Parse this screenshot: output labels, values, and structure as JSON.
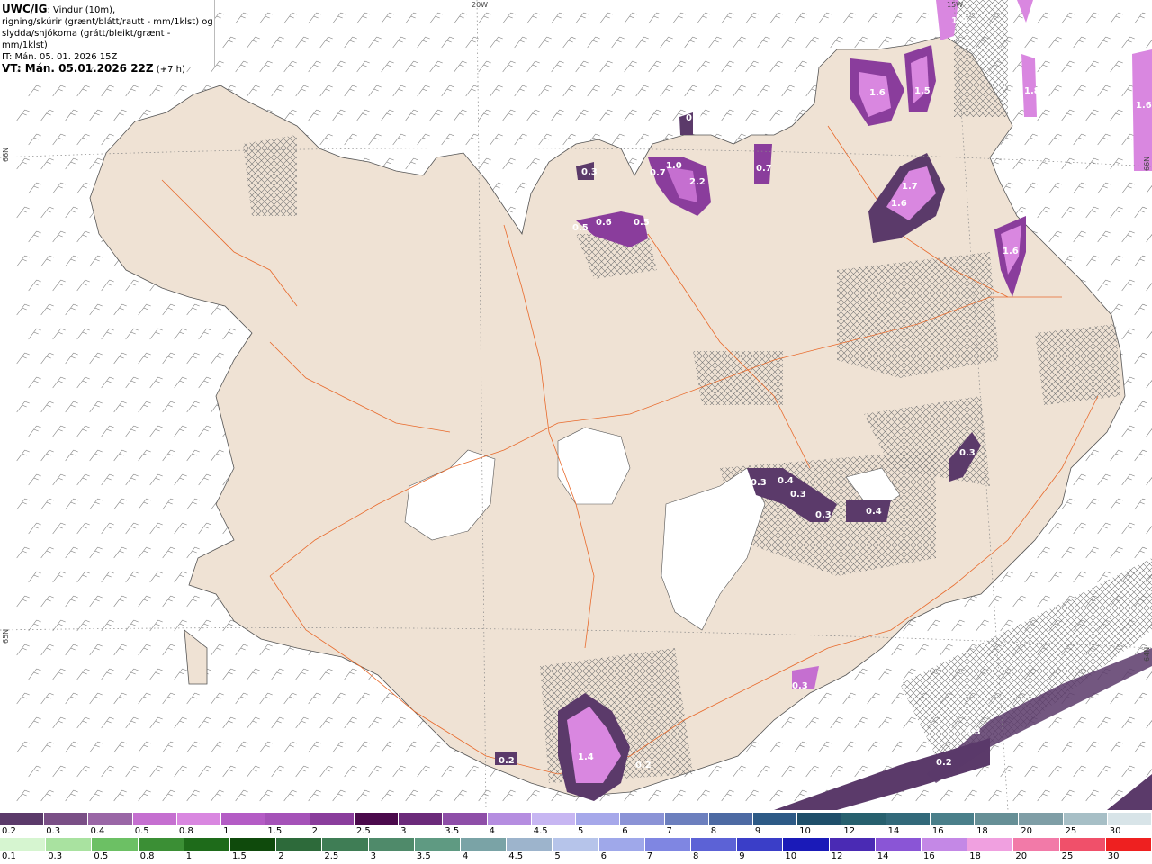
{
  "header": {
    "model": "UWC/IG",
    "line1_rest": ": Vindur (10m),",
    "line2": "rigning/skúrir (grænt/blátt/rautt - mm/1klst) og",
    "line3": "slydda/snjókoma (grátt/bleikt/grænt - mm/1klst)",
    "init_time": "IT: Mán. 05. 01. 2026 15Z",
    "valid_label": "VT: Mán. 05.01.2026 22Z",
    "valid_offset": "(+7 h)"
  },
  "grid_labels": [
    "20W",
    "15W",
    "66N",
    "65N",
    "66N",
    "64N"
  ],
  "precip_values": [
    "1.6",
    "1.5",
    "1.8",
    "1.8",
    "1.6",
    "1.7",
    "1.6",
    "1.6",
    "0.3",
    "0.7",
    "1.0",
    "2.2",
    "0.7",
    "0.5",
    "0.6",
    "0.5",
    "0.7",
    "0.3",
    "0.4",
    "0.3",
    "0.3",
    "0.4",
    "0.3",
    "1.4",
    "0.2",
    "0.3",
    "0.2",
    "0.2",
    "0.3"
  ],
  "legend": {
    "top_labels": [
      "0.2",
      "0.3",
      "0.4",
      "0.5",
      "0.8",
      "1",
      "1.5",
      "2",
      "2.5",
      "3",
      "3.5",
      "4",
      "4.5",
      "5",
      "6",
      "7",
      "8",
      "9",
      "10",
      "12",
      "14",
      "16",
      "18",
      "20",
      "25",
      "30"
    ],
    "top_colors": [
      "#5b3a6a",
      "#7a4f86",
      "#9a66a6",
      "#c56fd0",
      "#d987e0",
      "#b45cc5",
      "#a552b8",
      "#8a3d9c",
      "#4b0a4c",
      "#6b2a7a",
      "#8e4ea8",
      "#b58de0",
      "#c7b6f2",
      "#a6a8ea",
      "#8b93d6",
      "#6c7fbe",
      "#4d6aa3",
      "#2d5a86",
      "#1f4f6a",
      "#27606e",
      "#32697a",
      "#4a7f8a",
      "#668f96",
      "#7f9ea6",
      "#a7bfc6",
      "#d8e4e8"
    ],
    "bottom_labels": [
      "0.1",
      "0.3",
      "0.5",
      "0.8",
      "1",
      "1.5",
      "2",
      "2.5",
      "3",
      "3.5",
      "4",
      "4.5",
      "5",
      "6",
      "7",
      "8",
      "9",
      "10",
      "12",
      "14",
      "16",
      "18",
      "20",
      "25",
      "30"
    ],
    "bottom_colors": [
      "#d6f5d0",
      "#a9e2a0",
      "#6cc064",
      "#3b8f35",
      "#1e6b1a",
      "#0f4a0c",
      "#2d6a3a",
      "#3f7d55",
      "#4f8a6a",
      "#5f9a82",
      "#7aa3a6",
      "#9db4cc",
      "#b6c4ea",
      "#9fa8ea",
      "#7f86e2",
      "#5c62d6",
      "#3a3ec8",
      "#1a1ab8",
      "#4a2ab4",
      "#8a55d6",
      "#c488e6",
      "#f0a0e0",
      "#f27aa8",
      "#f0506a",
      "#ee2020"
    ]
  }
}
